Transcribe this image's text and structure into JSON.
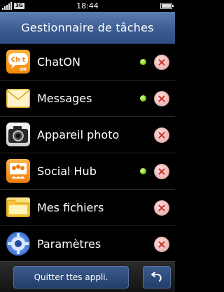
{
  "status_bar": {
    "network_label": "3G",
    "time": "18:44",
    "signal_icon": "signal-icon",
    "battery_icon": "battery-icon"
  },
  "header": {
    "title": "Gestionnaire de tâches"
  },
  "tasks": [
    {
      "name": "ChatON",
      "icon": "chaton-icon",
      "active": true
    },
    {
      "name": "Messages",
      "icon": "messages-icon",
      "active": true
    },
    {
      "name": "Appareil photo",
      "icon": "camera-icon",
      "active": false
    },
    {
      "name": "Social Hub",
      "icon": "social-hub-icon",
      "active": true
    },
    {
      "name": "Mes fichiers",
      "icon": "folder-icon",
      "active": false
    },
    {
      "name": "Paramètres",
      "icon": "settings-icon",
      "active": false
    }
  ],
  "task_icon_texts": {
    "chaton_top": "Ch t",
    "chaton_bottom": "ON"
  },
  "bottom_bar": {
    "quit_label": "Quitter ttes appli.",
    "back_icon": "back-icon"
  },
  "colors": {
    "header": "#3c5d92",
    "active_dot": "#7fd21a",
    "close_button": "#f0b6b6",
    "close_x": "#c0392b"
  }
}
